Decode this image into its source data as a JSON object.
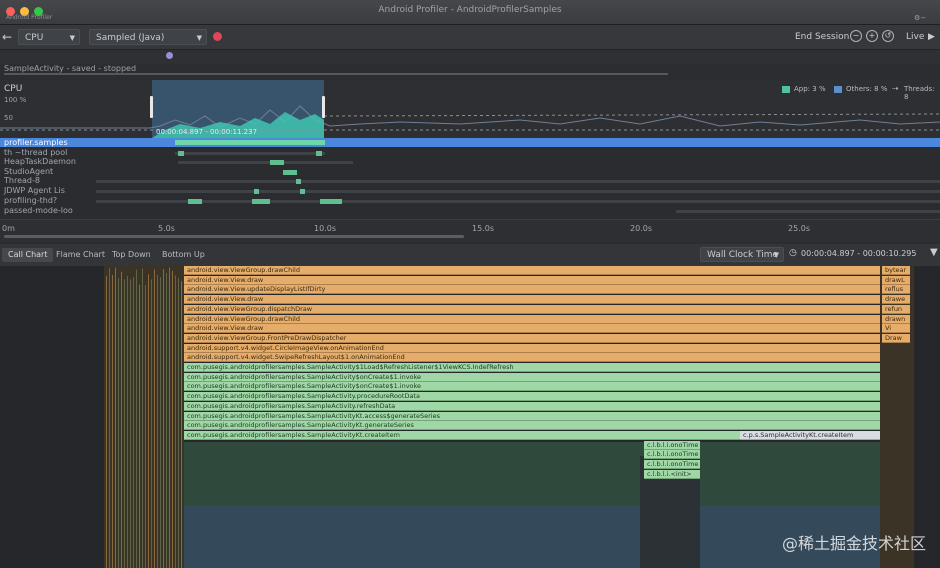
{
  "window": {
    "small_title": "Android Profiler",
    "title": "Android Profiler - AndroidProfilerSamples"
  },
  "toolbar": {
    "back_icon": "back-arrow-icon",
    "profiler_select": "CPU",
    "config_select": "Sampled (Java)",
    "end_session": "End Session",
    "live": "Live"
  },
  "breadcrumb": "SampleActivity - saved - stopped",
  "cpu": {
    "label": "CPU",
    "max": "100 %",
    "mid": "50",
    "selection": "00:00:04.897 - 00:00:11.237",
    "legend": [
      "App: 3 %",
      "Others: 8 %",
      "Threads: 8"
    ],
    "colors": {
      "app": "#4fc3a1",
      "others": "#5a8fd0",
      "selection": "#4682b4"
    }
  },
  "threads": [
    "profiler.samples",
    "th ~thread pool",
    "HeapTaskDaemon",
    "StudioAgent",
    "Thread-8",
    "JDWP Agent Lis",
    "profiling-thd?",
    "passed-mode-loo"
  ],
  "ruler": [
    "0m",
    "5.0s",
    "10.0s",
    "15.0s",
    "20.0s",
    "25.0s"
  ],
  "tabs": [
    "Call Chart",
    "Flame Chart",
    "Top Down",
    "Bottom Up"
  ],
  "clock": {
    "mode": "Wall Clock Time",
    "range": "00:00:04.897 - 00:00:10.295"
  },
  "frames": [
    "android.view.ViewGroup.drawChild",
    "android.view.View.draw",
    "android.view.View.updateDisplayListIfDirty",
    "android.view.View.draw",
    "android.view.ViewGroup.dispatchDraw",
    "android.view.ViewGroup.drawChild",
    "android.view.View.draw",
    "android.view.ViewGroup.FrontPreDrawDispatcher",
    "android.support.v4.widget.CircleImageView.onAnimationEnd",
    "android.support.v4.widget.SwipeRefreshLayout$1.onAnimationEnd",
    "com.pusegis.androidprofilersamples.SampleActivity$1Load$RefreshListener$1ViewKCS.IndefRefresh",
    "com.pusegis.androidprofilersamples.SampleActivity$onCreate$1.invoke",
    "com.pusegis.androidprofilersamples.SampleActivity$onCreate$1.invoke",
    "com.pusegis.androidprofilersamples.SampleActivity.procedureRootData",
    "com.pusegis.androidprofilersamples.SampleActivity.refreshData",
    "com.pusegis.androidprofilersamples.SampleActivityKt.access$generateSeries",
    "com.pusegis.androidprofilersamples.SampleActivityKt.generateSeries",
    "com.pusegis.androidprofilersamples.SampleActivityKt.createItem"
  ],
  "right_frames": [
    "bytear",
    "drawL",
    "reflus",
    "drawe",
    "refun",
    "drawn",
    "Vi",
    "Draw"
  ],
  "side_frame": "c.p.s.SampleActivityKt.createItem",
  "small_frames": [
    "c.l.b.l.i.onoTime",
    "c.l.b.l.i.onoTime",
    "c.l.b.l.i.onoTime",
    "c.l.b.l.i.<init>"
  ],
  "watermark": "@稀土掘金技术社区"
}
